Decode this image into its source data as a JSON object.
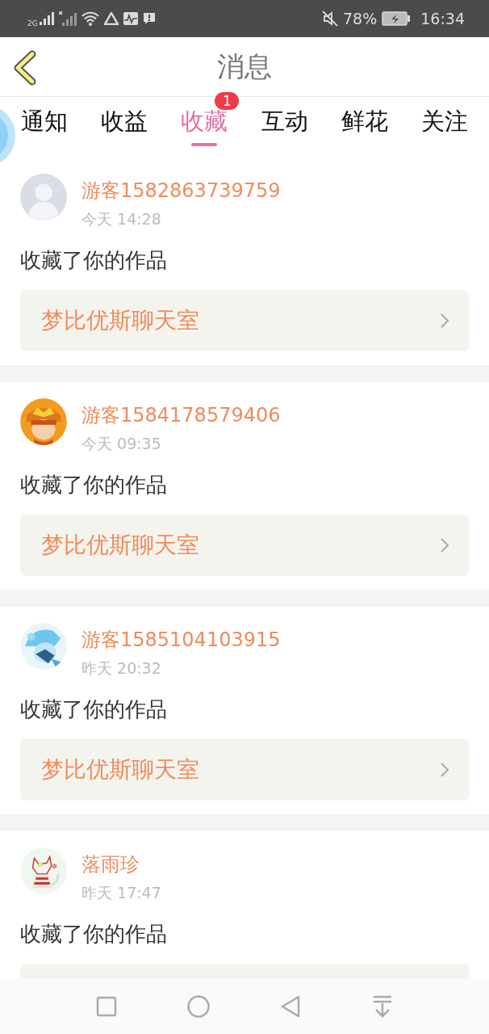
{
  "status_bar": {
    "network": "2G",
    "battery": "78%",
    "time": "16:34"
  },
  "header": {
    "title": "消息"
  },
  "tabs": [
    {
      "label": "通知",
      "selected": false
    },
    {
      "label": "收益",
      "selected": false
    },
    {
      "label": "收藏",
      "selected": true,
      "badge": "1"
    },
    {
      "label": "互动",
      "selected": false
    },
    {
      "label": "鲜花",
      "selected": false
    },
    {
      "label": "关注",
      "selected": false
    }
  ],
  "messages": [
    {
      "avatar": {
        "kind": "default"
      },
      "name": "游客1582863739759",
      "time": "今天 14:28",
      "text": "收藏了你的作品",
      "link": "梦比优斯聊天室"
    },
    {
      "name": "游客1584178579406",
      "time": "今天 09:35",
      "text": "收藏了你的作品",
      "link": "梦比优斯聊天室"
    },
    {
      "name": "游客1585104103915",
      "time": "昨天 20:32",
      "text": "收藏了你的作品",
      "link": "梦比优斯聊天室"
    },
    {
      "name": "落雨珍",
      "time": "昨天 17:47",
      "text": "收藏了你的作品"
    }
  ]
}
